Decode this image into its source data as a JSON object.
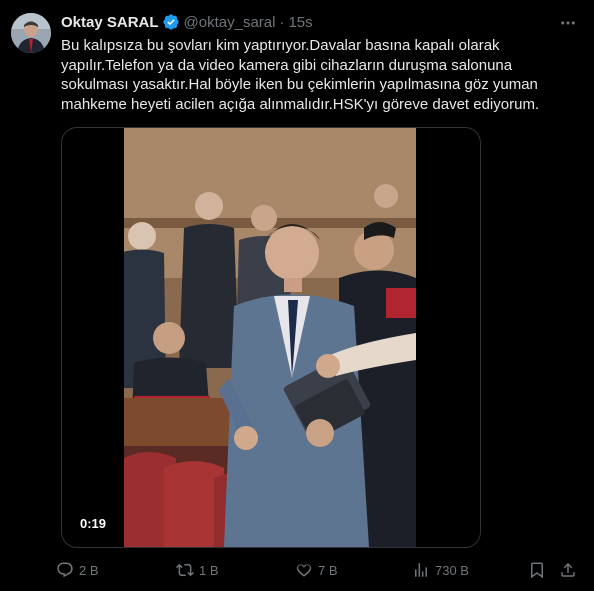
{
  "author": {
    "name": "Oktay SARAL",
    "handle": "@oktay_saral",
    "separator": "·",
    "time": "15s",
    "verified": true
  },
  "tweet": {
    "lines": [
      "Bu kalıpsıza bu şovları kim yaptırıyor.Davalar basına kapalı olarak",
      "yapılır.Telefon ya da video kamera gibi cihazların duruşma salonuna",
      "sokulması yasaktır.Hal böyle iken bu çekimlerin yapılmasına göz yuman",
      "mahkeme heyeti acilen açığa alınmalıdır.HSK'yı göreve davet ediyorum."
    ]
  },
  "video": {
    "duration": "0:19"
  },
  "actions": {
    "reply": {
      "icon": "reply-icon",
      "count": "2 B"
    },
    "retweet": {
      "icon": "retweet-icon",
      "count": "1 B"
    },
    "like": {
      "icon": "heart-icon",
      "count": "7 B"
    },
    "views": {
      "icon": "views-icon",
      "count": "730 B"
    },
    "bookmark": {
      "icon": "bookmark-icon"
    },
    "share": {
      "icon": "share-icon"
    }
  },
  "colors": {
    "background": "#000000",
    "text": "#e7e9ea",
    "muted": "#71767b",
    "verified": "#1d9bf0",
    "border": "#2f3336"
  }
}
